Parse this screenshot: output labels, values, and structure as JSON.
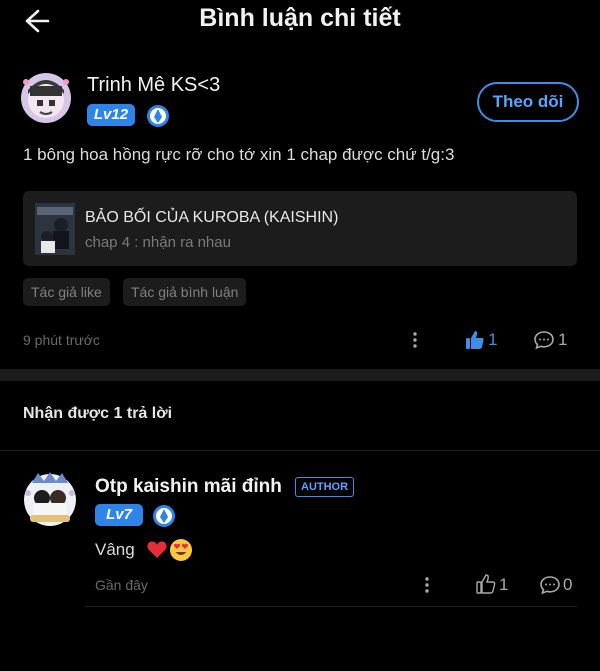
{
  "header": {
    "title": "Bình luận chi tiết"
  },
  "comment": {
    "username": "Trinh Mê KS<3",
    "level": "Lv12",
    "follow_label": "Theo dõi",
    "text": "1 bông hoa hồng rực rỡ cho tớ xin 1 chap được chứ t/g:3",
    "story": {
      "title": "BẢO BỐI CỦA KUROBA (KAISHIN)",
      "chapter": "chap 4 : nhận ra nhau"
    },
    "tags": [
      "Tác giả like",
      "Tác giả bình luận"
    ],
    "time": "9 phút trước",
    "likes": "1",
    "replies": "1"
  },
  "replies_heading": "Nhận được 1 trả lời",
  "reply": {
    "username": "Otp kaishin mãi đỉnh",
    "author_badge": "AUTHOR",
    "level": "Lv7",
    "text": "Vâng",
    "emojis": [
      "heart-icon",
      "heart-eyes-icon"
    ],
    "time": "Gần đây",
    "likes": "1",
    "replies": "0"
  },
  "colors": {
    "accent": "#3f8ee6",
    "badge": "#2f84e8",
    "background": "#000000",
    "card": "#1c1c1c"
  }
}
